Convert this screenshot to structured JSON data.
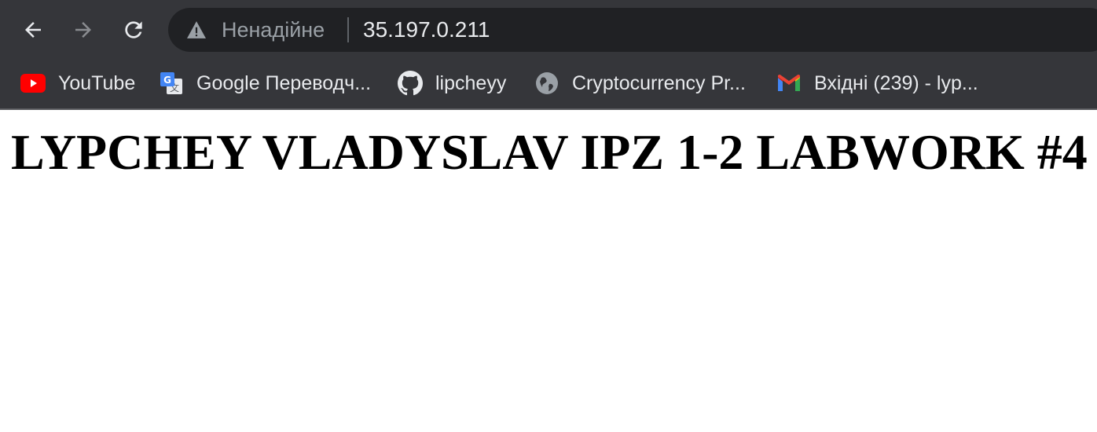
{
  "toolbar": {
    "security_label": "Ненадійне",
    "url": "35.197.0.211"
  },
  "bookmarks": [
    {
      "label": "YouTube",
      "icon": "youtube-icon"
    },
    {
      "label": "Google Переводч...",
      "icon": "google-translate-icon"
    },
    {
      "label": "lipcheyy",
      "icon": "github-icon"
    },
    {
      "label": "Cryptocurrency Pr...",
      "icon": "globe-icon"
    },
    {
      "label": "Вхідні (239) - lyp...",
      "icon": "gmail-icon"
    }
  ],
  "page": {
    "heading": "LYPCHEY VLADYSLAV IPZ 1-2 LABWORK #4"
  },
  "colors": {
    "toolbar_bg": "#35363a",
    "omnibox_bg": "#202124",
    "youtube_red": "#ff0000"
  }
}
